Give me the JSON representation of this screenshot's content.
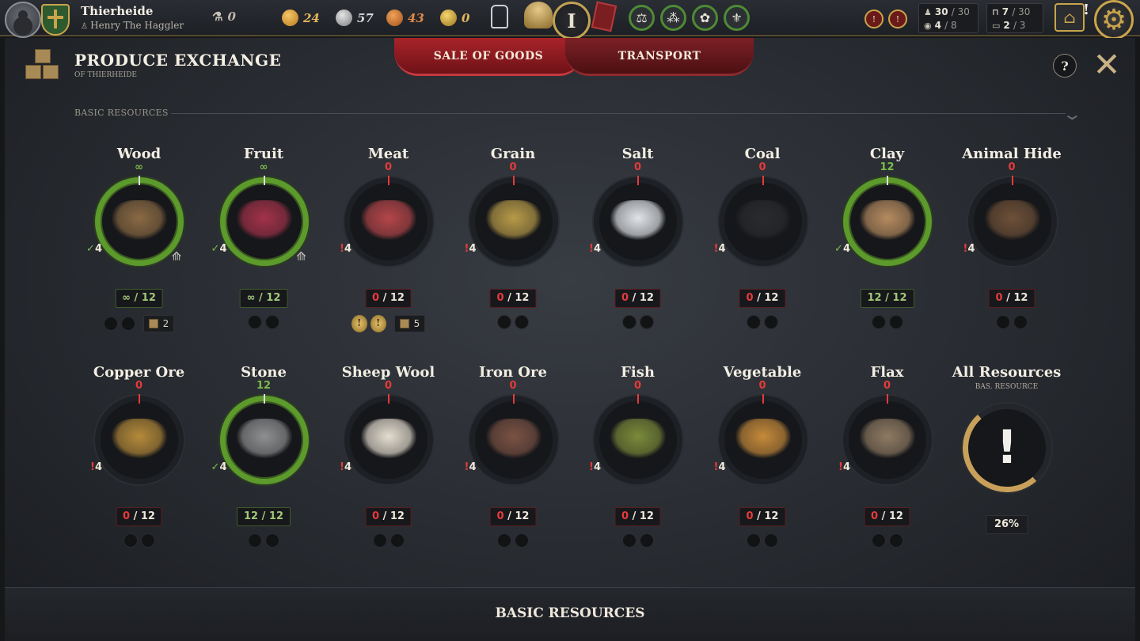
{
  "topbar": {
    "town_name": "Thierheide",
    "player_name": "Henry The Haggler",
    "influence": "0",
    "gold": "24",
    "silver": "57",
    "copper": "43",
    "crowns": "0",
    "rank": "I",
    "population": {
      "current": "30",
      "max": "/ 30"
    },
    "noble_pop": {
      "current": "4",
      "max": "/ 8"
    },
    "storage_a": {
      "current": "7",
      "max": "/ 30"
    },
    "storage_b": {
      "current": "2",
      "max": "/ 3"
    },
    "alert_mark": "!"
  },
  "panel": {
    "title": "PRODUCE EXCHANGE",
    "subtitle": "OF THIERHEIDE",
    "tabs": [
      {
        "label": "SALE OF GOODS",
        "active": true
      },
      {
        "label": "TRANSPORT",
        "active": false
      }
    ],
    "help_label": "?",
    "close_label": "✕",
    "section_label": "BASIC RESOURCES",
    "collapse_glyph": "⌄",
    "footer_label": "BASIC RESOURCES"
  },
  "resources": [
    {
      "name": "Wood",
      "count": "∞",
      "status": "full",
      "consumers": "4",
      "stock_cur": "∞",
      "stock_max": "/ 12",
      "crates": "2",
      "medals": 0,
      "level_badge": true,
      "color": "#8a6a44"
    },
    {
      "name": "Fruit",
      "count": "∞",
      "status": "full",
      "consumers": "4",
      "stock_cur": "∞",
      "stock_max": "/ 12",
      "crates": "",
      "medals": 0,
      "level_badge": true,
      "color": "#a2324a"
    },
    {
      "name": "Meat",
      "count": "0",
      "status": "empty",
      "consumers": "4",
      "stock_cur": "0",
      "stock_max": "/ 12",
      "crates": "5",
      "medals": 2,
      "level_badge": false,
      "color": "#b4464a"
    },
    {
      "name": "Grain",
      "count": "0",
      "status": "empty",
      "consumers": "4",
      "stock_cur": "0",
      "stock_max": "/ 12",
      "crates": "",
      "medals": 0,
      "level_badge": false,
      "color": "#b79a48"
    },
    {
      "name": "Salt",
      "count": "0",
      "status": "empty",
      "consumers": "4",
      "stock_cur": "0",
      "stock_max": "/ 12",
      "crates": "",
      "medals": 0,
      "level_badge": false,
      "color": "#e0e4e8"
    },
    {
      "name": "Coal",
      "count": "0",
      "status": "empty",
      "consumers": "4",
      "stock_cur": "0",
      "stock_max": "/ 12",
      "crates": "",
      "medals": 0,
      "level_badge": false,
      "color": "#2a2b2e"
    },
    {
      "name": "Clay",
      "count": "12",
      "status": "full",
      "consumers": "4",
      "stock_cur": "12",
      "stock_max": "/ 12",
      "crates": "",
      "medals": 0,
      "level_badge": false,
      "color": "#b58b5f"
    },
    {
      "name": "Animal Hide",
      "count": "0",
      "status": "empty",
      "consumers": "4",
      "stock_cur": "0",
      "stock_max": "/ 12",
      "crates": "",
      "medals": 0,
      "level_badge": false,
      "color": "#6e5038"
    },
    {
      "name": "Copper Ore",
      "count": "0",
      "status": "empty",
      "consumers": "4",
      "stock_cur": "0",
      "stock_max": "/ 12",
      "crates": "",
      "medals": 0,
      "level_badge": false,
      "color": "#b48a3a"
    },
    {
      "name": "Stone",
      "count": "12",
      "status": "full",
      "consumers": "4",
      "stock_cur": "12",
      "stock_max": "/ 12",
      "crates": "",
      "medals": 0,
      "level_badge": false,
      "color": "#8e8f90"
    },
    {
      "name": "Sheep Wool",
      "count": "0",
      "status": "empty",
      "consumers": "4",
      "stock_cur": "0",
      "stock_max": "/ 12",
      "crates": "",
      "medals": 0,
      "level_badge": false,
      "color": "#e4ddd0"
    },
    {
      "name": "Iron Ore",
      "count": "0",
      "status": "empty",
      "consumers": "4",
      "stock_cur": "0",
      "stock_max": "/ 12",
      "crates": "",
      "medals": 0,
      "level_badge": false,
      "color": "#7a5244"
    },
    {
      "name": "Fish",
      "count": "0",
      "status": "empty",
      "consumers": "4",
      "stock_cur": "0",
      "stock_max": "/ 12",
      "crates": "",
      "medals": 0,
      "level_badge": false,
      "color": "#7a8a3a"
    },
    {
      "name": "Vegetable",
      "count": "0",
      "status": "empty",
      "consumers": "4",
      "stock_cur": "0",
      "stock_max": "/ 12",
      "crates": "",
      "medals": 0,
      "level_badge": false,
      "color": "#c58a3a"
    },
    {
      "name": "Flax",
      "count": "0",
      "status": "empty",
      "consumers": "4",
      "stock_cur": "0",
      "stock_max": "/ 12",
      "crates": "",
      "medals": 0,
      "level_badge": false,
      "color": "#8e7a62"
    }
  ],
  "all_resources": {
    "name": "All Resources",
    "subtitle": "BAS. RESOURCE",
    "percent": "26%",
    "fill": 0.26,
    "mark": "!"
  }
}
